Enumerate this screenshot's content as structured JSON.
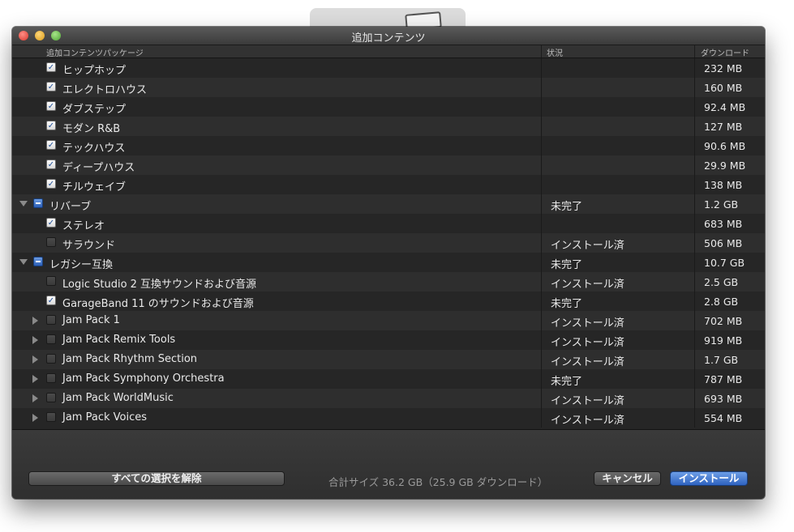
{
  "window": {
    "title": "追加コンテンツ"
  },
  "columns": {
    "name": "追加コンテンツパッケージ",
    "status": "状況",
    "download": "ダウンロード"
  },
  "rows": [
    {
      "label": "ヒップホップ",
      "status": "",
      "size": "232 MB",
      "checkbox": "checked",
      "indent": 1,
      "disclosure": "none"
    },
    {
      "label": "エレクトロハウス",
      "status": "",
      "size": "160 MB",
      "checkbox": "checked",
      "indent": 1,
      "disclosure": "none"
    },
    {
      "label": "ダブステップ",
      "status": "",
      "size": "92.4 MB",
      "checkbox": "checked",
      "indent": 1,
      "disclosure": "none"
    },
    {
      "label": "モダン R&B",
      "status": "",
      "size": "127 MB",
      "checkbox": "checked",
      "indent": 1,
      "disclosure": "none"
    },
    {
      "label": "テックハウス",
      "status": "",
      "size": "90.6 MB",
      "checkbox": "checked",
      "indent": 1,
      "disclosure": "none"
    },
    {
      "label": "ディープハウス",
      "status": "",
      "size": "29.9 MB",
      "checkbox": "checked",
      "indent": 1,
      "disclosure": "none"
    },
    {
      "label": "チルウェイブ",
      "status": "",
      "size": "138 MB",
      "checkbox": "checked",
      "indent": 1,
      "disclosure": "none"
    },
    {
      "label": "リバーブ",
      "status": "未完了",
      "size": "1.2 GB",
      "checkbox": "mixed",
      "indent": 0,
      "disclosure": "open"
    },
    {
      "label": "ステレオ",
      "status": "",
      "size": "683 MB",
      "checkbox": "checked",
      "indent": 1,
      "disclosure": "none"
    },
    {
      "label": "サラウンド",
      "status": "インストール済",
      "size": "506 MB",
      "checkbox": "unchecked",
      "indent": 1,
      "disclosure": "none"
    },
    {
      "label": "レガシー互換",
      "status": "未完了",
      "size": "10.7 GB",
      "checkbox": "mixed",
      "indent": 0,
      "disclosure": "open"
    },
    {
      "label": "Logic Studio 2 互換サウンドおよび音源",
      "status": "インストール済",
      "size": "2.5 GB",
      "checkbox": "unchecked",
      "indent": 1,
      "disclosure": "none"
    },
    {
      "label": "GarageBand 11 のサウンドおよび音源",
      "status": "未完了",
      "size": "2.8 GB",
      "checkbox": "checked",
      "indent": 1,
      "disclosure": "none"
    },
    {
      "label": "Jam Pack 1",
      "status": "インストール済",
      "size": "702 MB",
      "checkbox": "unchecked",
      "indent": 1,
      "disclosure": "closed"
    },
    {
      "label": "Jam Pack Remix Tools",
      "status": "インストール済",
      "size": "919 MB",
      "checkbox": "unchecked",
      "indent": 1,
      "disclosure": "closed"
    },
    {
      "label": "Jam Pack Rhythm Section",
      "status": "インストール済",
      "size": "1.7 GB",
      "checkbox": "unchecked",
      "indent": 1,
      "disclosure": "closed"
    },
    {
      "label": "Jam Pack Symphony Orchestra",
      "status": "未完了",
      "size": "787 MB",
      "checkbox": "unchecked",
      "indent": 1,
      "disclosure": "closed"
    },
    {
      "label": "Jam Pack WorldMusic",
      "status": "インストール済",
      "size": "693 MB",
      "checkbox": "unchecked",
      "indent": 1,
      "disclosure": "closed"
    },
    {
      "label": "Jam Pack Voices",
      "status": "インストール済",
      "size": "554 MB",
      "checkbox": "unchecked",
      "indent": 1,
      "disclosure": "closed"
    }
  ],
  "footer": {
    "deselect_all_label": "すべての選択を解除",
    "total_text": "合計サイズ 36.2 GB（25.9 GB ダウンロード）",
    "cancel_label": "キャンセル",
    "install_label": "インストール"
  }
}
